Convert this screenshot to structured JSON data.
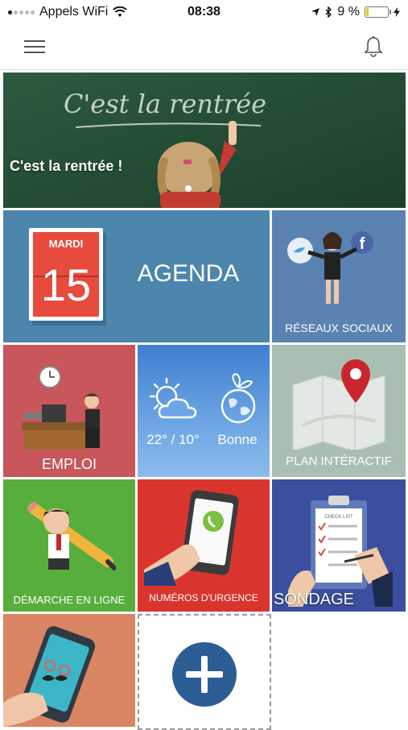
{
  "status_bar": {
    "carrier": "Appels WiFi",
    "time": "08:38",
    "battery": "9 %"
  },
  "nav": {
    "menu_icon": "hamburger-menu-icon",
    "notification_icon": "bell-icon"
  },
  "banner": {
    "chalk_text": "C'est la rentrée",
    "caption": "C'est la rentrée !"
  },
  "tiles": {
    "agenda": {
      "day_name": "MARDI",
      "day_number": "15",
      "label": "AGENDA"
    },
    "social": {
      "label": "RÉSEAUX SOCIAUX"
    },
    "emploi": {
      "label": "EMPLOI"
    },
    "weather": {
      "temps": "22° / 10°",
      "quality": "Bonne"
    },
    "plan": {
      "label": "PLAN INTÉRACTIF"
    },
    "demarche": {
      "label": "DÉMARCHE EN LIGNE"
    },
    "urgence": {
      "label": "NUMÉROS D'URGENCE"
    },
    "sondage": {
      "label": "SONDAGE",
      "clipboard_title": "CHECK LIST"
    }
  },
  "colors": {
    "agenda": "#4d86ac",
    "social": "#5b83b1",
    "emploi": "#c8565b",
    "plan": "#a9bfb1",
    "demarche": "#58ae3d",
    "urgence": "#d9352e",
    "sondage": "#3a4f9e",
    "app": "#d98462",
    "add_button": "#2c5d95"
  }
}
